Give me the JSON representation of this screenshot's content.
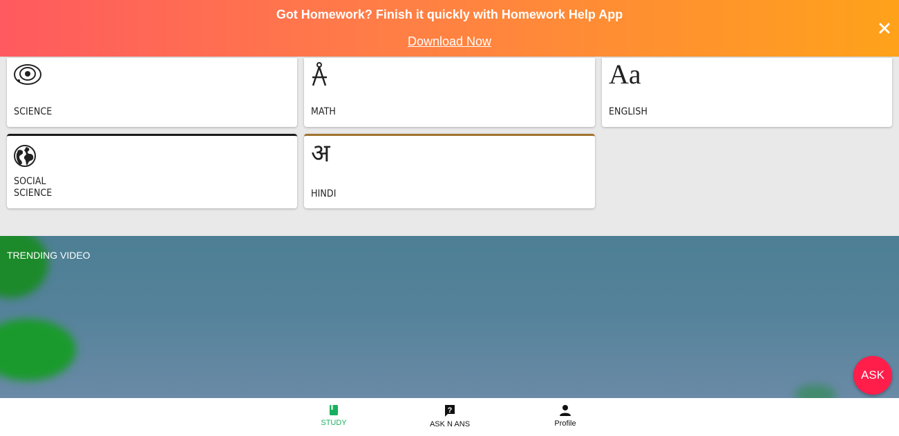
{
  "promo": {
    "title": "Got Homework? Finish it quickly with Homework Help App",
    "link": "Download Now",
    "close_icon": "close-icon"
  },
  "subjects": [
    {
      "label": "SCIENCE",
      "icon": "atom-icon"
    },
    {
      "label": "MATH",
      "icon": "compass-icon"
    },
    {
      "label": "ENGLISH",
      "icon": "letters-aa-icon",
      "icon_text": "Aa"
    },
    {
      "label": "SOCIAL\nSCIENCE",
      "icon": "globe-icon",
      "top_border": "#1a1a1a"
    },
    {
      "label": "HINDI",
      "icon": "hindi-letter-icon",
      "icon_text": "अ",
      "top_border": "#a0732e"
    }
  ],
  "trending": {
    "title": "TRENDING VIDEO"
  },
  "ask_button": {
    "label": "ASK",
    "color": "#ff1d4a"
  },
  "bottom_nav": {
    "items": [
      {
        "label": "STUDY",
        "icon": "book-icon",
        "active": true,
        "color": "#1aaf5d"
      },
      {
        "label": "ASK N ANS",
        "icon": "question-icon",
        "active": false
      },
      {
        "label": "Profile",
        "icon": "person-icon",
        "active": false
      }
    ]
  }
}
